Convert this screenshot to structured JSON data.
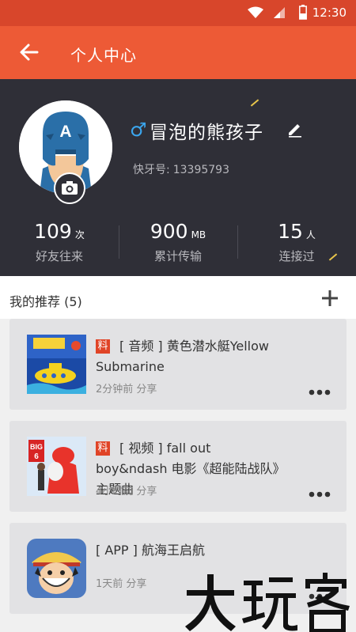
{
  "status_bar": {
    "time": "12:30"
  },
  "app_bar": {
    "title": "个人中心"
  },
  "profile": {
    "gender_symbol": "♂",
    "name": "冒泡的熊孩子",
    "bluetooth_label": "快牙号:",
    "bluetooth_id": "13395793",
    "stats": [
      {
        "value": "109",
        "unit": "次",
        "label": "好友往来"
      },
      {
        "value": "900",
        "unit": "MB",
        "label": "累计传输"
      },
      {
        "value": "15",
        "unit": "人",
        "label": "连接过"
      }
    ]
  },
  "recommend": {
    "title": "我的推荐 (5)",
    "items": [
      {
        "tag": "料",
        "title": "[ 音频 ] 黄色潜水艇Yellow Submarine",
        "meta": "2分钟前 分享",
        "thumb": "beatles-cover"
      },
      {
        "tag": "料",
        "title": "[ 视频 ] fall out boy&ndash 电影《超能陆战队》主题曲",
        "meta": "4小时前 分享",
        "thumb": "big-hero-6-cover"
      },
      {
        "tag": "",
        "title": "[ APP ] 航海王启航",
        "meta": "1天前 分享",
        "thumb": "one-piece-app-icon"
      }
    ]
  },
  "watermark": "大玩客",
  "colors": {
    "accent": "#ed5a36",
    "status_bar": "#d8462b",
    "profile_bg": "#2f2f37",
    "gender": "#3ba6ee",
    "tag": "#e04427"
  }
}
